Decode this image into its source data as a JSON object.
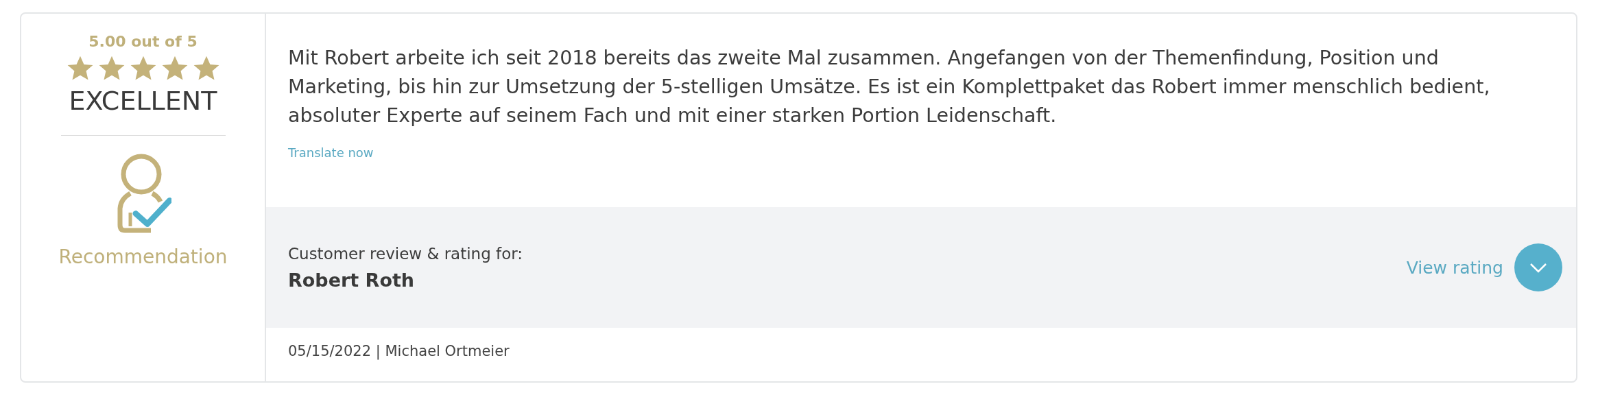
{
  "summary": {
    "score": "5.00 out of 5",
    "stars": 5,
    "verdict": "EXCELLENT",
    "recommendation": "Recommendation"
  },
  "review": {
    "text": "Mit Robert arbeite ich seit 2018 bereits das zweite Mal zusammen. Angefangen von der Themenfindung, Position und Marketing, bis hin zur Umsetzung der 5-stelligen Umsätze. Es ist ein Komplettpaket das Robert immer menschlich bedient, absoluter Experte auf seinem Fach und mit einer starken Portion Leidenschaft.",
    "translate_link": "Translate now"
  },
  "subject": {
    "label": "Customer review & rating for:",
    "name": "Robert Roth",
    "view_rating": "View rating",
    "expanded": false
  },
  "footer": {
    "meta": "05/15/2022 | Michael Ortmeier"
  }
}
